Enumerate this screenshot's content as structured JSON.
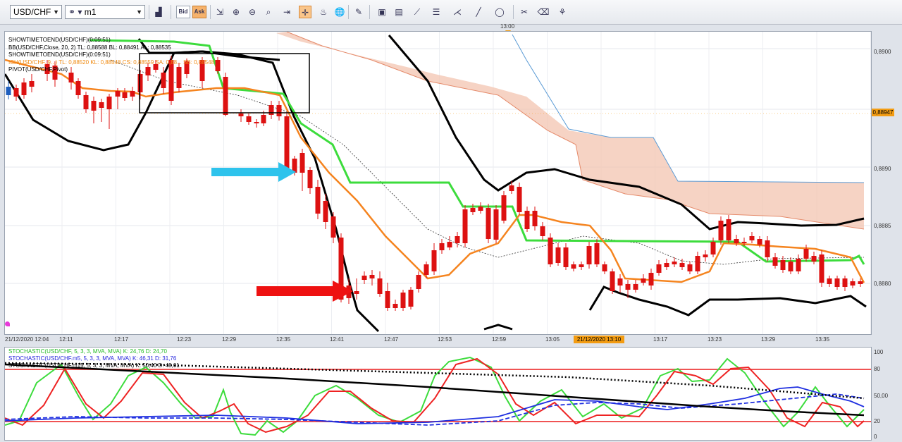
{
  "toolbar": {
    "symbol": "USD/CHF",
    "timeframe": "m1",
    "bid_label": "Bid",
    "ask_label": "Ask"
  },
  "chart": {
    "top_time_label": "13:00",
    "current_price": "0,88947",
    "crosshair_time": "21/12/2020 13:10",
    "price_axis": [
      "0,8900",
      "0,8890",
      "0,8885",
      "0,8880"
    ],
    "time_axis": [
      "21/12/2020 12:04",
      "12:11",
      "12:17",
      "12:23",
      "12:29",
      "12:35",
      "12:41",
      "12:47",
      "12:53",
      "12:59",
      "13:05",
      "13:17",
      "13:23",
      "13:29",
      "13:35"
    ],
    "legend": [
      {
        "text": "SHOWTIMETOEND(USD/CHF)(0:09:51)",
        "color": "#000000"
      },
      {
        "text": "BB(USD/CHF,Close, 20, 2)  TL: 0,88588  BL: 0,88491  AL: 0,88535",
        "color": "#000000"
      },
      {
        "text": "SHOWTIMETOEND(USD/CHF)(0:09:51)",
        "color": "#000000"
      },
      {
        "text": "ICH(USD/CHF, 9...)  TL: 0,88520  KL: 0,88548  CS: 0,88559  SA: 0,88...  SB: 0,88548",
        "color": "#f08a10"
      },
      {
        "text": "PIVOT(USD/CHF,Pivot)",
        "color": "#000000"
      }
    ]
  },
  "indicator": {
    "legend": [
      {
        "text": "STOCHASTIC(USD/CHF, 5, 3, 3, MVA, MVA)  K: 24,76  D: 24,70",
        "color": "#22bb22"
      },
      {
        "text": "STOCHASTIC(USD/CHF.m5, 5, 3, 3, MVA, MVA)  K: 46,31  D: 31,76",
        "color": "#2222dd"
      },
      {
        "text": "STOCHASTIC(USD/CHF.m15, 5, 3, 3, MVA, MVA)  K: 50,40  D: 48,01",
        "color": "#000000"
      }
    ],
    "levels": [
      "100",
      "80",
      "50,00",
      "20",
      "0"
    ]
  },
  "colors": {
    "bull": "#1f5fbf",
    "bear": "#dd1111",
    "orange": "#f5841f",
    "green": "#3cdc3c",
    "cloud": "#f3c4b0",
    "arrow_blue": "#2ec3ec",
    "arrow_red": "#ee1111"
  }
}
